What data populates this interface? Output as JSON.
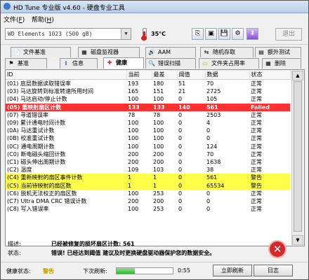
{
  "window": {
    "title": "HD Tune 专业版 v4.60 - 硬盘专业工具"
  },
  "menu": {
    "file": "文件",
    "file_key": "F",
    "help": "帮助",
    "help_key": "H"
  },
  "toolbar": {
    "drive": "WD     Elements 1023     (500 gB)",
    "temperature": "35°C",
    "exit": "退出"
  },
  "tabs": [
    {
      "label": "文件基准",
      "icon": "file-benchmark-icon"
    },
    {
      "label": "磁盘监视器",
      "icon": "disk-monitor-icon"
    },
    {
      "label": "AAM",
      "icon": "speaker-icon"
    },
    {
      "label": "随机存取",
      "icon": "random-access-icon"
    },
    {
      "label": "额外测试",
      "icon": "extra-tests-icon"
    },
    {
      "label": "基准",
      "icon": "benchmark-icon"
    },
    {
      "label": "信息",
      "icon": "info-icon"
    },
    {
      "label": "健康",
      "icon": "health-icon"
    },
    {
      "label": "错误扫描",
      "icon": "error-scan-icon"
    },
    {
      "label": "文件夹占用率",
      "icon": "folder-usage-icon"
    },
    {
      "label": "删除",
      "icon": "erase-icon"
    }
  ],
  "table": {
    "headers": [
      "ID",
      "当前",
      "最差",
      "阈值",
      "数据",
      "状态"
    ],
    "rows": [
      [
        "(01) 底层数据读取错误率",
        "193",
        "180",
        "51",
        "70",
        "正常"
      ],
      [
        "(03) 马达旋转到标准转速所用时间",
        "165",
        "151",
        "21",
        "2725",
        "正常"
      ],
      [
        "(04) 马达启动/停止计数",
        "100",
        "100",
        "0",
        "105",
        "正常"
      ],
      [
        "(05) 重映射扇区计数",
        "133",
        "133",
        "140",
        "561",
        "Failed"
      ],
      [
        "(07) 寻道错误率",
        "78",
        "78",
        "0",
        "2503",
        "正常"
      ],
      [
        "(09) 累计通电时间计数",
        "100",
        "100",
        "0",
        "4",
        "正常"
      ],
      [
        "(0A) 马达重试计数",
        "100",
        "100",
        "0",
        "0",
        "正常"
      ],
      [
        "(0B) 校准重试计数",
        "100",
        "100",
        "0",
        "0",
        "正常"
      ],
      [
        "(0C) 通电周期计数",
        "100",
        "100",
        "0",
        "124",
        "正常"
      ],
      [
        "(C0) 断电磁头缩回计数",
        "200",
        "200",
        "0",
        "70",
        "正常"
      ],
      [
        "(C1) 磁头伸出周期计数",
        "200",
        "200",
        "0",
        "1638",
        "正常"
      ],
      [
        "(C2) 温度",
        "109",
        "103",
        "0",
        "38",
        "正常"
      ],
      [
        "(C4) 重新映射的扇区事件计数",
        "1",
        "1",
        "0",
        "561",
        "警告"
      ],
      [
        "(C5) 当前待映射的扇区数",
        "1",
        "1",
        "0",
        "65534",
        "警告"
      ],
      [
        "(C6) 脱机无法校正的扇区数",
        "100",
        "253",
        "0",
        "0",
        "正常"
      ],
      [
        "(C7) Ultra DMA CRC 错误计数",
        "200",
        "200",
        "0",
        "0",
        "正常"
      ],
      [
        "(C8) 写入错误率",
        "100",
        "253",
        "0",
        "0",
        "正常"
      ]
    ],
    "row_styles": [
      "",
      "",
      "",
      "red",
      "",
      "",
      "",
      "",
      "",
      "",
      "",
      "",
      "yellow",
      "yellow",
      "",
      "",
      ""
    ]
  },
  "info": {
    "desc_label": "描述:",
    "desc_value": "已经被修复的损坏扇区计数: 561",
    "state_label": "状态:",
    "state_value": "错误! 已经达到阈值 建议及时更换硬盘驱动器保护您的数据安全。"
  },
  "status": {
    "health_label": "健康状态:",
    "health_value": "警告",
    "refresh_label": "下次刷新:",
    "progress": 0.32,
    "timer": "0:55",
    "refresh_button": "立即刷新",
    "log_button": "日志"
  },
  "colors": {
    "failed_row": "#ff3030",
    "warning_row": "#ffff4a",
    "warning_text": "#c8a000",
    "progress": "#33b233"
  }
}
